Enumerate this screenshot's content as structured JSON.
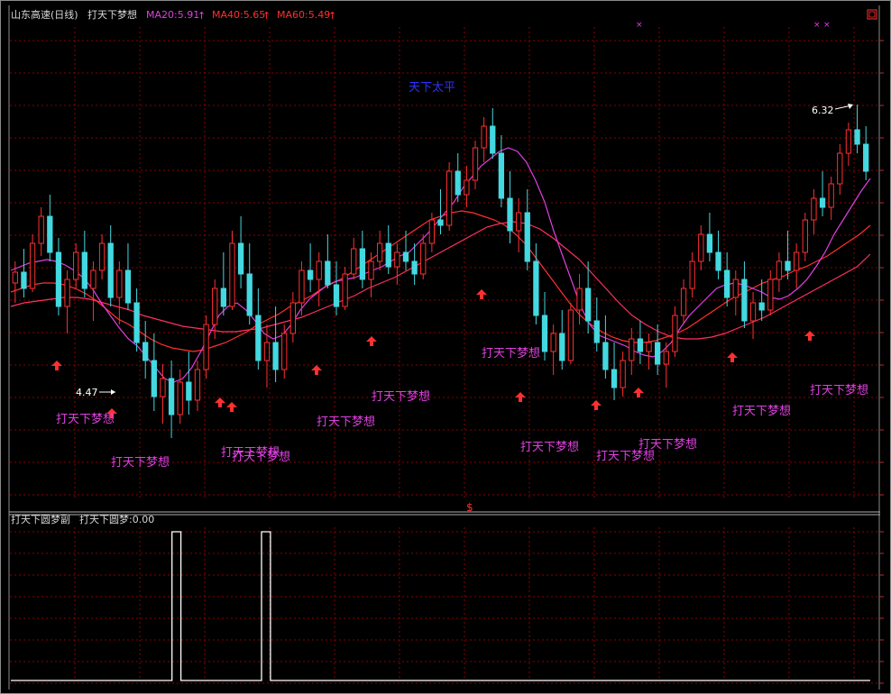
{
  "header": {
    "stock": "山东高速(日线)",
    "indicator": "打天下梦想",
    "ma20": "MA20:5.91",
    "ma40": "MA40:5.65",
    "ma60": "MA60:5.49",
    "arrow": "↑"
  },
  "colors": {
    "bg": "#000000",
    "grid": "#8b0000",
    "up": "#ff3030",
    "down": "#44d8e0",
    "ma20": "#e040e0",
    "ma40": "#ff3030",
    "ma60": "#ff3060",
    "signal": "#e040e0",
    "title_blue": "#3030ff",
    "white": "#ffffff"
  },
  "annotations": {
    "top_label": "天下太平",
    "low_label": "4.47",
    "high_label": "6.32",
    "divider_mark": "$",
    "signal_label": "打天下梦想",
    "overlap_label": "打天下梦想"
  },
  "sub_panel": {
    "title": "打天下圆梦副",
    "value_label": "打天下圆梦:0.00"
  },
  "chart_data": {
    "type": "candlestick",
    "title": "山东高速(日线)",
    "series": [
      {
        "name": "MA20",
        "last": 5.91
      },
      {
        "name": "MA40",
        "last": 5.65
      },
      {
        "name": "MA60",
        "last": 5.49
      }
    ],
    "low_price": 4.47,
    "high_price": 6.32,
    "candles": [
      {
        "o": 5.33,
        "h": 5.45,
        "l": 5.22,
        "c": 5.39
      },
      {
        "o": 5.39,
        "h": 5.52,
        "l": 5.25,
        "c": 5.3
      },
      {
        "o": 5.3,
        "h": 5.6,
        "l": 5.28,
        "c": 5.55
      },
      {
        "o": 5.55,
        "h": 5.75,
        "l": 5.48,
        "c": 5.7
      },
      {
        "o": 5.7,
        "h": 5.82,
        "l": 5.45,
        "c": 5.5
      },
      {
        "o": 5.5,
        "h": 5.58,
        "l": 5.15,
        "c": 5.2
      },
      {
        "o": 5.2,
        "h": 5.4,
        "l": 5.05,
        "c": 5.35
      },
      {
        "o": 5.35,
        "h": 5.55,
        "l": 5.3,
        "c": 5.5
      },
      {
        "o": 5.5,
        "h": 5.62,
        "l": 5.25,
        "c": 5.3
      },
      {
        "o": 5.3,
        "h": 5.45,
        "l": 5.12,
        "c": 5.4
      },
      {
        "o": 5.4,
        "h": 5.6,
        "l": 5.35,
        "c": 5.55
      },
      {
        "o": 5.55,
        "h": 5.65,
        "l": 5.2,
        "c": 5.25
      },
      {
        "o": 5.25,
        "h": 5.45,
        "l": 5.1,
        "c": 5.4
      },
      {
        "o": 5.4,
        "h": 5.55,
        "l": 5.18,
        "c": 5.22
      },
      {
        "o": 5.22,
        "h": 5.3,
        "l": 4.95,
        "c": 5.0
      },
      {
        "o": 5.0,
        "h": 5.12,
        "l": 4.8,
        "c": 4.9
      },
      {
        "o": 4.9,
        "h": 5.05,
        "l": 4.62,
        "c": 4.7
      },
      {
        "o": 4.7,
        "h": 4.88,
        "l": 4.55,
        "c": 4.8
      },
      {
        "o": 4.8,
        "h": 4.9,
        "l": 4.47,
        "c": 4.6
      },
      {
        "o": 4.6,
        "h": 4.85,
        "l": 4.55,
        "c": 4.78
      },
      {
        "o": 4.78,
        "h": 4.95,
        "l": 4.6,
        "c": 4.68
      },
      {
        "o": 4.68,
        "h": 4.9,
        "l": 4.62,
        "c": 4.85
      },
      {
        "o": 4.85,
        "h": 5.15,
        "l": 4.8,
        "c": 5.1
      },
      {
        "o": 5.1,
        "h": 5.35,
        "l": 5.02,
        "c": 5.3
      },
      {
        "o": 5.3,
        "h": 5.5,
        "l": 5.15,
        "c": 5.2
      },
      {
        "o": 5.2,
        "h": 5.62,
        "l": 5.18,
        "c": 5.55
      },
      {
        "o": 5.55,
        "h": 5.7,
        "l": 5.3,
        "c": 5.38
      },
      {
        "o": 5.38,
        "h": 5.55,
        "l": 5.1,
        "c": 5.15
      },
      {
        "o": 5.15,
        "h": 5.3,
        "l": 4.85,
        "c": 4.9
      },
      {
        "o": 4.9,
        "h": 5.1,
        "l": 4.75,
        "c": 5.0
      },
      {
        "o": 5.0,
        "h": 5.2,
        "l": 4.78,
        "c": 4.85
      },
      {
        "o": 4.85,
        "h": 5.1,
        "l": 4.8,
        "c": 5.05
      },
      {
        "o": 5.05,
        "h": 5.28,
        "l": 5.0,
        "c": 5.22
      },
      {
        "o": 5.22,
        "h": 5.45,
        "l": 5.15,
        "c": 5.4
      },
      {
        "o": 5.4,
        "h": 5.55,
        "l": 5.28,
        "c": 5.35
      },
      {
        "o": 5.35,
        "h": 5.5,
        "l": 5.2,
        "c": 5.45
      },
      {
        "o": 5.45,
        "h": 5.6,
        "l": 5.3,
        "c": 5.32
      },
      {
        "o": 5.32,
        "h": 5.45,
        "l": 5.15,
        "c": 5.2
      },
      {
        "o": 5.2,
        "h": 5.42,
        "l": 5.18,
        "c": 5.38
      },
      {
        "o": 5.38,
        "h": 5.58,
        "l": 5.35,
        "c": 5.52
      },
      {
        "o": 5.52,
        "h": 5.62,
        "l": 5.3,
        "c": 5.35
      },
      {
        "o": 5.35,
        "h": 5.5,
        "l": 5.25,
        "c": 5.45
      },
      {
        "o": 5.45,
        "h": 5.62,
        "l": 5.4,
        "c": 5.55
      },
      {
        "o": 5.55,
        "h": 5.65,
        "l": 5.38,
        "c": 5.42
      },
      {
        "o": 5.42,
        "h": 5.55,
        "l": 5.32,
        "c": 5.5
      },
      {
        "o": 5.5,
        "h": 5.62,
        "l": 5.4,
        "c": 5.45
      },
      {
        "o": 5.45,
        "h": 5.55,
        "l": 5.32,
        "c": 5.38
      },
      {
        "o": 5.38,
        "h": 5.6,
        "l": 5.35,
        "c": 5.55
      },
      {
        "o": 5.55,
        "h": 5.72,
        "l": 5.5,
        "c": 5.68
      },
      {
        "o": 5.68,
        "h": 5.85,
        "l": 5.6,
        "c": 5.65
      },
      {
        "o": 5.65,
        "h": 6.0,
        "l": 5.62,
        "c": 5.95
      },
      {
        "o": 5.95,
        "h": 6.05,
        "l": 5.78,
        "c": 5.82
      },
      {
        "o": 5.82,
        "h": 5.98,
        "l": 5.75,
        "c": 5.9
      },
      {
        "o": 5.9,
        "h": 6.12,
        "l": 5.85,
        "c": 6.08
      },
      {
        "o": 6.08,
        "h": 6.25,
        "l": 6.0,
        "c": 6.2
      },
      {
        "o": 6.2,
        "h": 6.3,
        "l": 6.02,
        "c": 6.05
      },
      {
        "o": 6.05,
        "h": 6.15,
        "l": 5.75,
        "c": 5.8
      },
      {
        "o": 5.8,
        "h": 5.95,
        "l": 5.55,
        "c": 5.62
      },
      {
        "o": 5.62,
        "h": 5.8,
        "l": 5.5,
        "c": 5.72
      },
      {
        "o": 5.72,
        "h": 5.85,
        "l": 5.4,
        "c": 5.45
      },
      {
        "o": 5.45,
        "h": 5.55,
        "l": 5.1,
        "c": 5.15
      },
      {
        "o": 5.15,
        "h": 5.28,
        "l": 4.9,
        "c": 4.95
      },
      {
        "o": 4.95,
        "h": 5.1,
        "l": 4.82,
        "c": 5.05
      },
      {
        "o": 5.05,
        "h": 5.18,
        "l": 4.85,
        "c": 4.9
      },
      {
        "o": 4.9,
        "h": 5.22,
        "l": 4.88,
        "c": 5.18
      },
      {
        "o": 5.18,
        "h": 5.38,
        "l": 5.1,
        "c": 5.3
      },
      {
        "o": 5.3,
        "h": 5.45,
        "l": 5.05,
        "c": 5.12
      },
      {
        "o": 5.12,
        "h": 5.25,
        "l": 4.95,
        "c": 5.0
      },
      {
        "o": 5.0,
        "h": 5.15,
        "l": 4.8,
        "c": 4.85
      },
      {
        "o": 4.85,
        "h": 5.0,
        "l": 4.68,
        "c": 4.75
      },
      {
        "o": 4.75,
        "h": 4.95,
        "l": 4.7,
        "c": 4.9
      },
      {
        "o": 4.9,
        "h": 5.08,
        "l": 4.82,
        "c": 5.02
      },
      {
        "o": 5.02,
        "h": 5.12,
        "l": 4.88,
        "c": 4.95
      },
      {
        "o": 4.95,
        "h": 5.05,
        "l": 4.85,
        "c": 5.0
      },
      {
        "o": 5.0,
        "h": 5.1,
        "l": 4.82,
        "c": 4.88
      },
      {
        "o": 4.88,
        "h": 5.0,
        "l": 4.75,
        "c": 4.95
      },
      {
        "o": 4.95,
        "h": 5.2,
        "l": 4.92,
        "c": 5.15
      },
      {
        "o": 5.15,
        "h": 5.35,
        "l": 5.1,
        "c": 5.3
      },
      {
        "o": 5.3,
        "h": 5.5,
        "l": 5.25,
        "c": 5.45
      },
      {
        "o": 5.45,
        "h": 5.65,
        "l": 5.4,
        "c": 5.6
      },
      {
        "o": 5.6,
        "h": 5.72,
        "l": 5.45,
        "c": 5.5
      },
      {
        "o": 5.5,
        "h": 5.62,
        "l": 5.35,
        "c": 5.4
      },
      {
        "o": 5.4,
        "h": 5.5,
        "l": 5.2,
        "c": 5.25
      },
      {
        "o": 5.25,
        "h": 5.4,
        "l": 5.15,
        "c": 5.35
      },
      {
        "o": 5.35,
        "h": 5.45,
        "l": 5.08,
        "c": 5.12
      },
      {
        "o": 5.12,
        "h": 5.28,
        "l": 5.02,
        "c": 5.22
      },
      {
        "o": 5.22,
        "h": 5.35,
        "l": 5.12,
        "c": 5.18
      },
      {
        "o": 5.18,
        "h": 5.4,
        "l": 5.15,
        "c": 5.35
      },
      {
        "o": 5.35,
        "h": 5.5,
        "l": 5.28,
        "c": 5.45
      },
      {
        "o": 5.45,
        "h": 5.62,
        "l": 5.35,
        "c": 5.4
      },
      {
        "o": 5.4,
        "h": 5.55,
        "l": 5.3,
        "c": 5.5
      },
      {
        "o": 5.5,
        "h": 5.72,
        "l": 5.45,
        "c": 5.68
      },
      {
        "o": 5.68,
        "h": 5.85,
        "l": 5.6,
        "c": 5.8
      },
      {
        "o": 5.8,
        "h": 5.95,
        "l": 5.7,
        "c": 5.75
      },
      {
        "o": 5.75,
        "h": 5.92,
        "l": 5.68,
        "c": 5.88
      },
      {
        "o": 5.88,
        "h": 6.1,
        "l": 5.82,
        "c": 6.05
      },
      {
        "o": 6.05,
        "h": 6.22,
        "l": 5.98,
        "c": 6.18
      },
      {
        "o": 6.18,
        "h": 6.32,
        "l": 6.05,
        "c": 6.1
      },
      {
        "o": 6.1,
        "h": 6.2,
        "l": 5.9,
        "c": 5.95
      }
    ],
    "ma20": [
      5.4,
      5.42,
      5.44,
      5.45,
      5.46,
      5.45,
      5.43,
      5.4,
      5.36,
      5.3,
      5.22,
      5.15,
      5.08,
      5.02,
      4.98,
      4.92,
      4.86,
      4.8,
      4.78,
      4.8,
      4.86,
      4.95,
      5.05,
      5.15,
      5.2,
      5.22,
      5.18,
      5.12,
      5.05,
      5.02,
      5.04,
      5.1,
      5.18,
      5.24,
      5.28,
      5.32,
      5.34,
      5.35,
      5.36,
      5.38,
      5.4,
      5.42,
      5.45,
      5.48,
      5.5,
      5.55,
      5.6,
      5.66,
      5.72,
      5.78,
      5.86,
      5.92,
      5.98,
      6.02,
      6.06,
      6.08,
      6.06,
      6.0,
      5.9,
      5.78,
      5.62,
      5.48,
      5.34,
      5.2,
      5.1,
      5.04,
      5.02,
      5.0,
      4.98,
      4.95,
      4.93,
      4.92,
      4.95,
      5.0,
      5.08,
      5.15,
      5.2,
      5.25,
      5.3,
      5.32,
      5.33,
      5.32,
      5.3,
      5.28,
      5.25,
      5.24,
      5.26,
      5.3,
      5.35,
      5.42,
      5.5,
      5.6,
      5.68,
      5.76,
      5.84,
      5.91
    ],
    "ma40": [
      5.28,
      5.3,
      5.32,
      5.33,
      5.33,
      5.32,
      5.3,
      5.27,
      5.23,
      5.18,
      5.13,
      5.1,
      5.06,
      5.02,
      4.99,
      4.97,
      4.96,
      4.95,
      4.96,
      4.98,
      5.0,
      5.03,
      5.06,
      5.1,
      5.13,
      5.16,
      5.2,
      5.23,
      5.26,
      5.3,
      5.33,
      5.36,
      5.4,
      5.44,
      5.48,
      5.52,
      5.56,
      5.6,
      5.64,
      5.68,
      5.7,
      5.72,
      5.73,
      5.72,
      5.7,
      5.68,
      5.65,
      5.6,
      5.54,
      5.46,
      5.38,
      5.3,
      5.22,
      5.15,
      5.1,
      5.06,
      5.03,
      5.01,
      5.0,
      5.0,
      5.01,
      5.03,
      5.05,
      5.08,
      5.12,
      5.16,
      5.2,
      5.24,
      5.27,
      5.3,
      5.33,
      5.35,
      5.37,
      5.4,
      5.42,
      5.45,
      5.48,
      5.52,
      5.56,
      5.6,
      5.65
    ],
    "ma60": [
      5.2,
      5.22,
      5.23,
      5.24,
      5.25,
      5.25,
      5.24,
      5.22,
      5.2,
      5.18,
      5.15,
      5.13,
      5.11,
      5.09,
      5.08,
      5.07,
      5.06,
      5.06,
      5.07,
      5.08,
      5.1,
      5.12,
      5.14,
      5.17,
      5.2,
      5.23,
      5.26,
      5.3,
      5.33,
      5.36,
      5.4,
      5.44,
      5.48,
      5.52,
      5.56,
      5.6,
      5.64,
      5.66,
      5.67,
      5.66,
      5.63,
      5.58,
      5.52,
      5.46,
      5.38,
      5.3,
      5.22,
      5.15,
      5.1,
      5.06,
      5.03,
      5.02,
      5.02,
      5.03,
      5.05,
      5.08,
      5.11,
      5.14,
      5.18,
      5.22,
      5.26,
      5.3,
      5.34,
      5.38,
      5.42,
      5.49
    ],
    "sub_series": [
      0,
      0,
      0,
      0,
      0,
      0,
      0,
      0,
      0,
      0,
      0,
      0,
      0,
      0,
      0,
      0,
      0,
      0,
      1,
      0,
      0,
      0,
      0,
      0,
      0,
      0,
      0,
      0,
      1,
      0,
      0,
      0,
      0,
      0,
      0,
      0,
      0,
      0,
      0,
      0,
      0,
      0,
      0,
      0,
      0,
      0,
      0,
      0,
      0,
      0,
      0,
      0,
      0,
      0,
      0,
      0,
      0,
      0,
      0,
      0,
      0,
      0,
      0,
      0,
      0,
      0,
      0,
      0,
      0,
      0,
      0,
      0,
      0,
      0,
      0,
      0,
      0,
      0,
      0,
      0,
      0,
      0,
      0,
      0,
      0,
      0,
      0,
      0,
      0,
      0,
      0,
      0,
      0,
      0,
      0,
      0
    ]
  }
}
